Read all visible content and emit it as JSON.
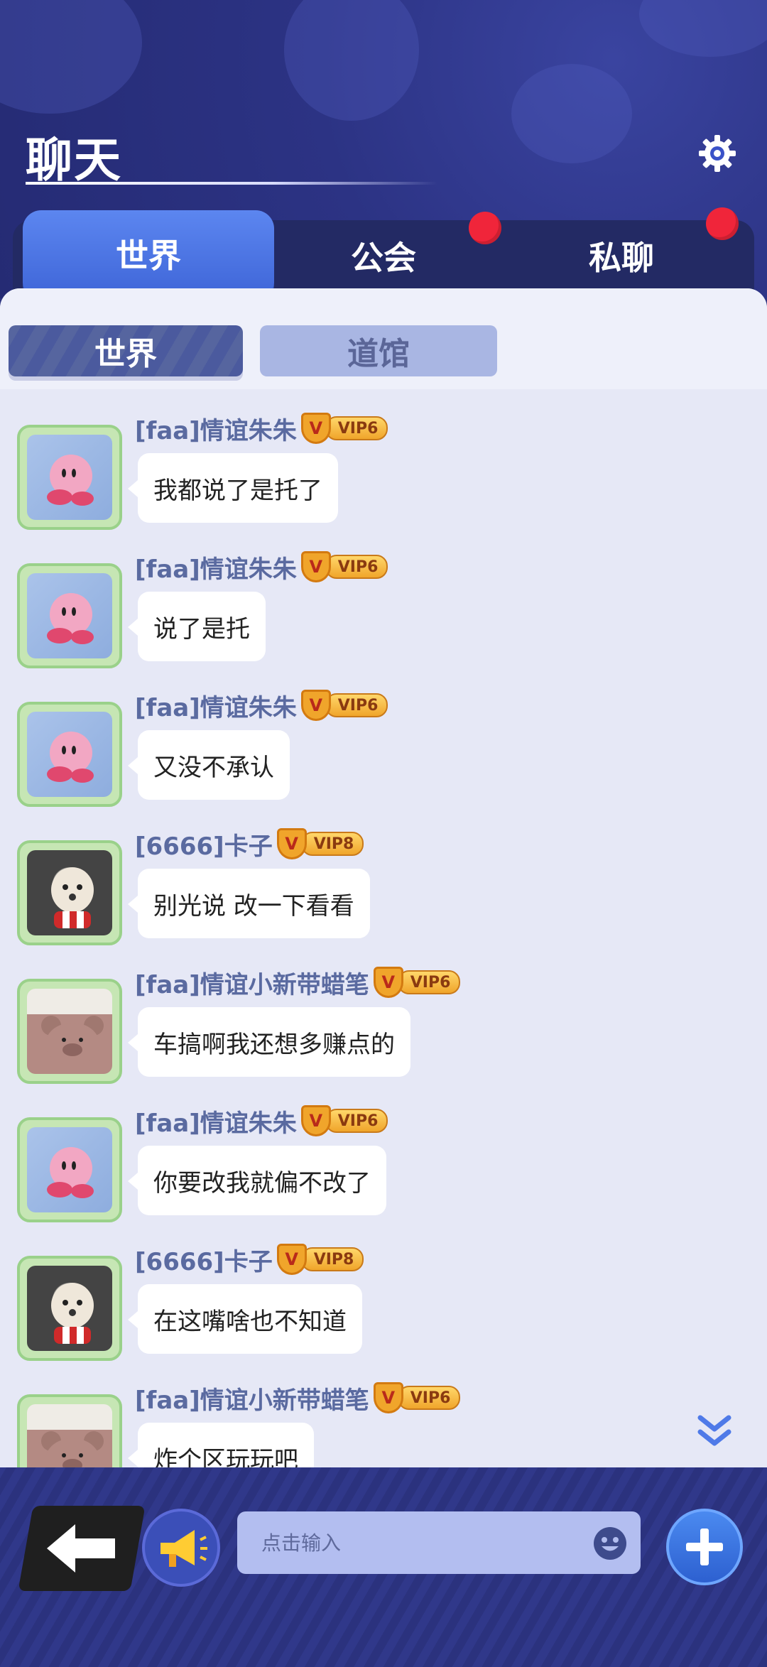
{
  "header": {
    "title": "聊天",
    "settings_icon": "gear-icon"
  },
  "tabs": [
    {
      "label": "世界",
      "active": true,
      "badge": false
    },
    {
      "label": "公会",
      "active": false,
      "badge": true
    },
    {
      "label": "私聊",
      "active": false,
      "badge": true
    }
  ],
  "subtabs": [
    {
      "label": "世界",
      "active": true
    },
    {
      "label": "道馆",
      "active": false
    }
  ],
  "messages": [
    {
      "name": "[faa]情谊朱朱",
      "vip": "VIP6",
      "text": "我都说了是托了",
      "avatar": "kirby"
    },
    {
      "name": "[faa]情谊朱朱",
      "vip": "VIP6",
      "text": "说了是托",
      "avatar": "kirby"
    },
    {
      "name": "[faa]情谊朱朱",
      "vip": "VIP6",
      "text": "又没不承认",
      "avatar": "kirby"
    },
    {
      "name": "[6666]卡子",
      "vip": "VIP8",
      "text": "别光说 改一下看看",
      "avatar": "dog"
    },
    {
      "name": "[faa]情谊小新带蜡笔",
      "vip": "VIP6",
      "text": "车搞啊我还想多赚点的",
      "avatar": "bear"
    },
    {
      "name": "[faa]情谊朱朱",
      "vip": "VIP6",
      "text": "你要改我就偏不改了",
      "avatar": "kirby"
    },
    {
      "name": "[6666]卡子",
      "vip": "VIP8",
      "text": "在这嘴啥也不知道",
      "avatar": "dog"
    },
    {
      "name": "[faa]情谊小新带蜡笔",
      "vip": "VIP6",
      "text": "炸个区玩玩吧",
      "avatar": "bear"
    }
  ],
  "vip_shield_letter": "V",
  "input": {
    "placeholder": "点击输入"
  },
  "icons": {
    "back": "back-arrow-icon",
    "horn": "megaphone-icon",
    "emoji": "emoji-icon",
    "plus": "plus-icon",
    "scroll": "double-chevron-down-icon"
  },
  "colors": {
    "accent": "#4f78e6",
    "badge": "#f0253a",
    "panel": "#e6e8f6",
    "bar": "#2e3580"
  }
}
